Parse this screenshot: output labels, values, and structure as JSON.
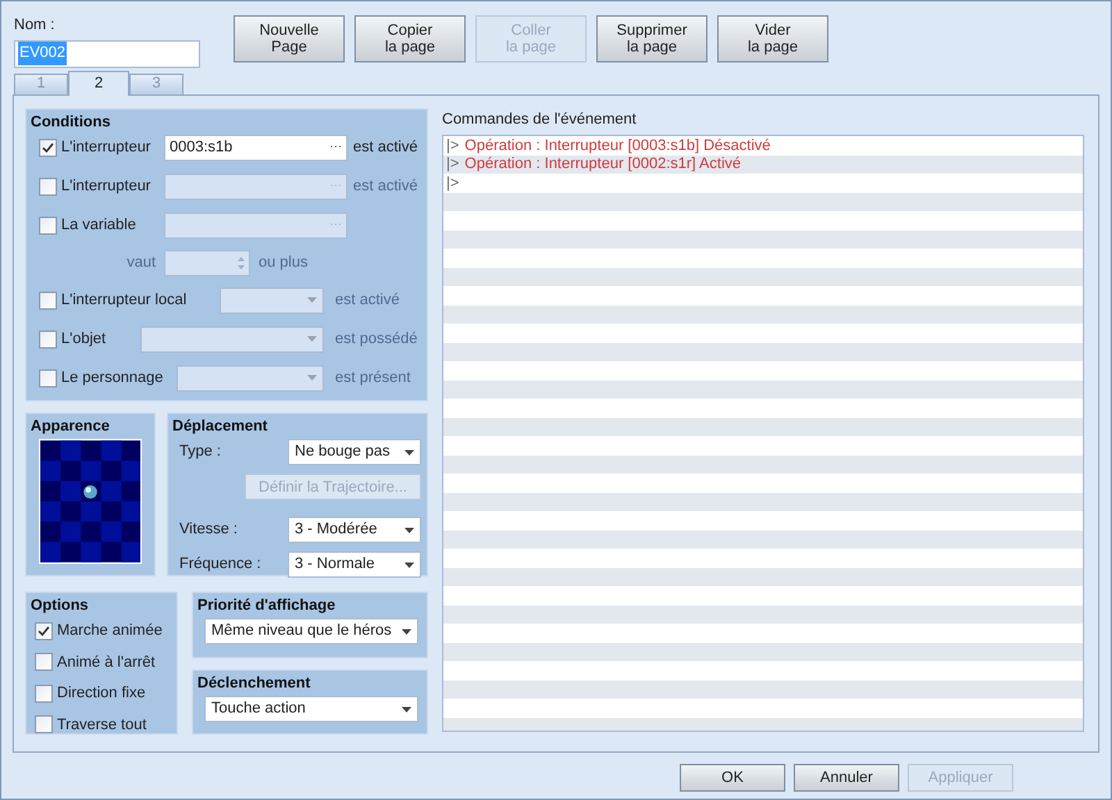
{
  "name": {
    "label": "Nom :",
    "value": "EV002"
  },
  "page_buttons": [
    {
      "label": "Nouvelle\nPage",
      "disabled": false
    },
    {
      "label": "Copier\nla page",
      "disabled": false
    },
    {
      "label": "Coller\nla page",
      "disabled": true
    },
    {
      "label": "Supprimer\nla page",
      "disabled": false
    },
    {
      "label": "Vider\nla page",
      "disabled": false
    }
  ],
  "tabs": [
    {
      "label": "1",
      "selected": false
    },
    {
      "label": "2",
      "selected": true
    },
    {
      "label": "3",
      "selected": false
    }
  ],
  "conditions": {
    "title": "Conditions",
    "rows": [
      {
        "kind": "picker",
        "label": "L'interrupteur",
        "checked": true,
        "value": "0003:s1b",
        "button": "···",
        "suffix": "est activé"
      },
      {
        "kind": "picker",
        "label": "L'interrupteur",
        "checked": false,
        "button": "···",
        "suffix": "est activé"
      },
      {
        "kind": "picker",
        "label": "La variable",
        "checked": false,
        "button": "···"
      },
      {
        "kind": "spin",
        "label": "vaut",
        "suffix": "ou plus"
      },
      {
        "kind": "select",
        "label": "L'interrupteur local",
        "checked": false,
        "suffix": "est activé"
      },
      {
        "kind": "select",
        "label": "L'objet",
        "checked": false,
        "suffix": "est possédé"
      },
      {
        "kind": "select",
        "label": "Le personnage",
        "checked": false,
        "suffix": "est présent"
      }
    ]
  },
  "appearance": {
    "title": "Apparence"
  },
  "movement": {
    "title": "Déplacement",
    "rows": [
      {
        "kind": "select",
        "label": "Type :",
        "value": "Ne bouge pas"
      },
      {
        "kind": "button",
        "label": "Définir la Trajectoire...",
        "disabled": true
      },
      {
        "kind": "select",
        "label": "Vitesse :",
        "value": "3 - Modérée"
      },
      {
        "kind": "select",
        "label": "Fréquence :",
        "value": "3 - Normale"
      }
    ]
  },
  "options": {
    "title": "Options",
    "items": [
      {
        "label": "Marche animée",
        "checked": true
      },
      {
        "label": "Animé à l'arrêt",
        "checked": false
      },
      {
        "label": "Direction fixe",
        "checked": false
      },
      {
        "label": "Traverse tout",
        "checked": false
      }
    ]
  },
  "priority": {
    "title": "Priorité d'affichage",
    "value": "Même niveau que le héros"
  },
  "trigger": {
    "title": "Déclenchement",
    "value": "Touche action"
  },
  "commands": {
    "title": "Commandes de l'événement",
    "lines": [
      {
        "prefix": "|>",
        "text": "Opération : Interrupteur [0003:s1b] Désactivé"
      },
      {
        "prefix": "|>",
        "text": "Opération : Interrupteur [0002:s1r] Activé"
      },
      {
        "prefix": "|>"
      }
    ]
  },
  "footer_buttons": [
    {
      "label": "OK",
      "disabled": false
    },
    {
      "label": "Annuler",
      "disabled": false
    },
    {
      "label": "Appliquer",
      "disabled": true
    }
  ]
}
